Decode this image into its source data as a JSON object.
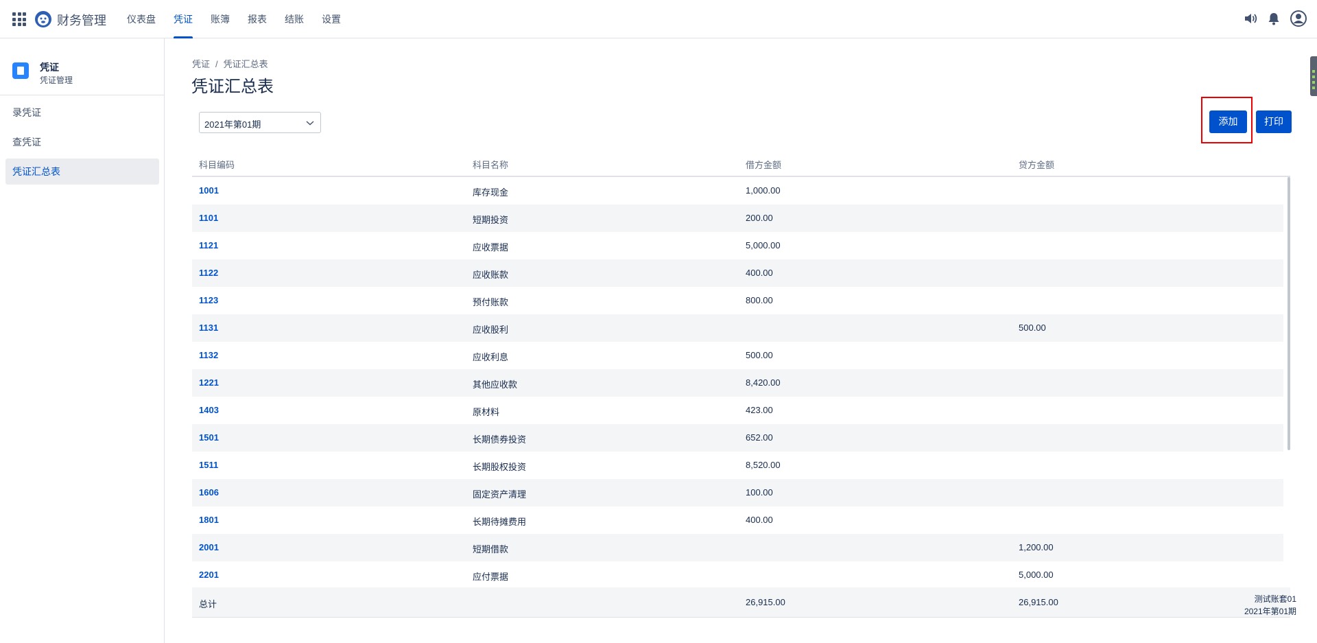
{
  "app": {
    "brand": "财务管理",
    "nav": [
      "仪表盘",
      "凭证",
      "账簿",
      "报表",
      "结账",
      "设置"
    ],
    "active_nav_index": 1,
    "icons": [
      "app-grid-icon",
      "monkey-logo-icon",
      "speaker-icon",
      "bell-icon",
      "user-avatar-icon"
    ]
  },
  "sidebar": {
    "title": "凭证",
    "subtitle": "凭证管理",
    "items": [
      "录凭证",
      "查凭证",
      "凭证汇总表"
    ],
    "active_index": 2
  },
  "breadcrumb": [
    "凭证",
    "凭证汇总表"
  ],
  "page_title": "凭证汇总表",
  "period_select": {
    "value": "2021年第01期"
  },
  "buttons": {
    "add": "添加",
    "print": "打印"
  },
  "table": {
    "headers": [
      "科目编码",
      "科目名称",
      "借方金额",
      "贷方金额"
    ],
    "rows": [
      {
        "code": "1001",
        "name": "库存现金",
        "debit": "1,000.00",
        "credit": ""
      },
      {
        "code": "1101",
        "name": "短期投资",
        "debit": "200.00",
        "credit": ""
      },
      {
        "code": "1121",
        "name": "应收票据",
        "debit": "5,000.00",
        "credit": ""
      },
      {
        "code": "1122",
        "name": "应收账款",
        "debit": "400.00",
        "credit": ""
      },
      {
        "code": "1123",
        "name": "预付账款",
        "debit": "800.00",
        "credit": ""
      },
      {
        "code": "1131",
        "name": "应收股利",
        "debit": "",
        "credit": "500.00"
      },
      {
        "code": "1132",
        "name": "应收利息",
        "debit": "500.00",
        "credit": ""
      },
      {
        "code": "1221",
        "name": "其他应收款",
        "debit": "8,420.00",
        "credit": ""
      },
      {
        "code": "1403",
        "name": "原材料",
        "debit": "423.00",
        "credit": ""
      },
      {
        "code": "1501",
        "name": "长期债券投资",
        "debit": "652.00",
        "credit": ""
      },
      {
        "code": "1511",
        "name": "长期股权投资",
        "debit": "8,520.00",
        "credit": ""
      },
      {
        "code": "1606",
        "name": "固定资产清理",
        "debit": "100.00",
        "credit": ""
      },
      {
        "code": "1801",
        "name": "长期待摊费用",
        "debit": "400.00",
        "credit": ""
      },
      {
        "code": "2001",
        "name": "短期借款",
        "debit": "",
        "credit": "1,200.00"
      },
      {
        "code": "2201",
        "name": "应付票据",
        "debit": "",
        "credit": "5,000.00"
      }
    ],
    "total": {
      "label": "总计",
      "debit": "26,915.00",
      "credit": "26,915.00"
    }
  },
  "account_info": {
    "account": "测试账套01",
    "period": "2021年第01期"
  }
}
